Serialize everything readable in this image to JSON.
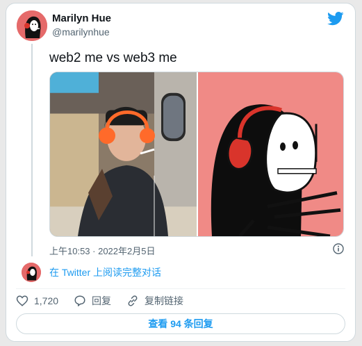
{
  "author": {
    "name": "Marilyn Hue",
    "handle": "@marilynhue"
  },
  "tweet": {
    "text": "web2 me vs web3 me",
    "timestamp": "上午10:53 · 2022年2月5日"
  },
  "reply_prompt": "在 Twitter 上阅读完整对话",
  "actions": {
    "like_count": "1,720",
    "reply_label": "回复",
    "copy_link_label": "复制链接"
  },
  "view_replies_label": "查看 94 条回复",
  "colors": {
    "brand_blue": "#1d9bf0",
    "avatar_red": "#e56a6a"
  },
  "icons": [
    "twitter-bird-icon",
    "info-icon",
    "heart-icon",
    "reply-icon",
    "link-icon"
  ]
}
